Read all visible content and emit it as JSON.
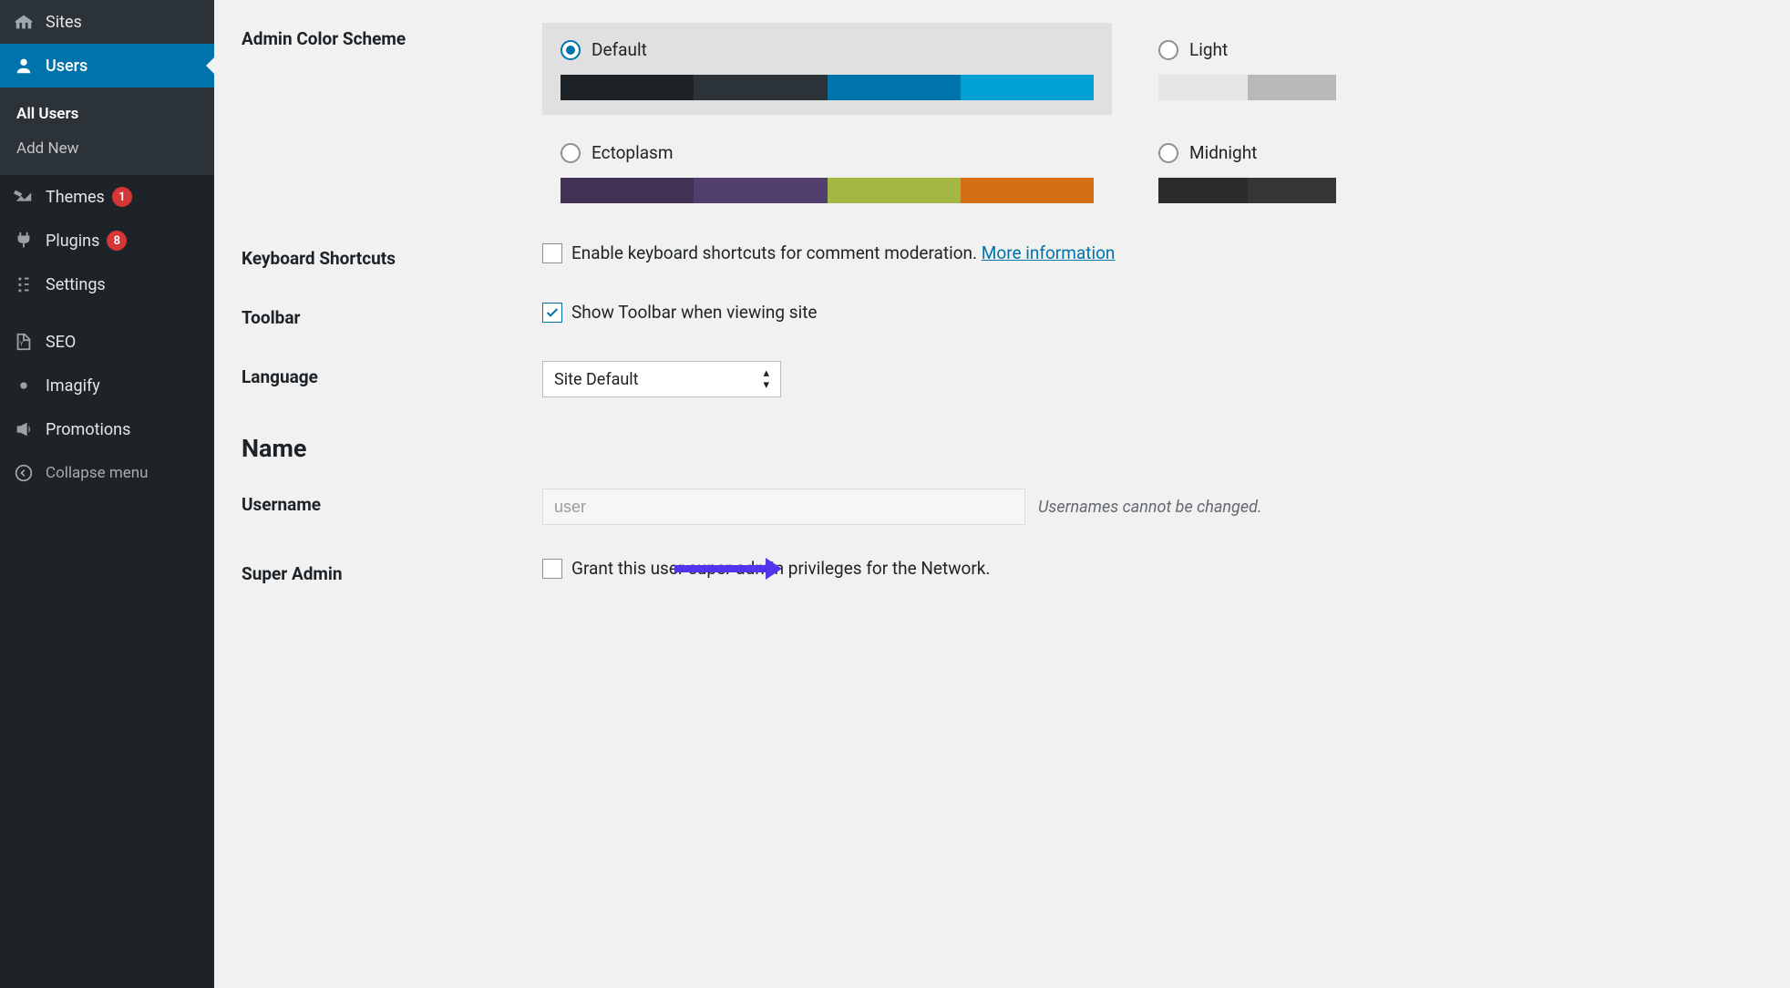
{
  "sidebar": {
    "items": [
      {
        "name": "sites",
        "label": "Sites",
        "icon": "sites-icon"
      },
      {
        "name": "users",
        "label": "Users",
        "icon": "users-icon",
        "active": true
      },
      {
        "name": "themes",
        "label": "Themes",
        "icon": "themes-icon",
        "badge": "1"
      },
      {
        "name": "plugins",
        "label": "Plugins",
        "icon": "plugins-icon",
        "badge": "8"
      },
      {
        "name": "settings",
        "label": "Settings",
        "icon": "settings-icon"
      },
      {
        "name": "seo",
        "label": "SEO",
        "icon": "seo-icon"
      },
      {
        "name": "imagify",
        "label": "Imagify",
        "icon": "imagify-icon"
      },
      {
        "name": "promotions",
        "label": "Promotions",
        "icon": "promotions-icon"
      }
    ],
    "submenu": {
      "items": [
        {
          "label": "All Users",
          "current": true
        },
        {
          "label": "Add New",
          "current": false
        }
      ]
    },
    "collapse_label": "Collapse menu"
  },
  "form": {
    "color_scheme_label": "Admin Color Scheme",
    "schemes": {
      "default": {
        "label": "Default",
        "colors": [
          "#1d2327",
          "#2c3338",
          "#0073aa",
          "#00a0d2"
        ]
      },
      "light": {
        "label": "Light",
        "colors": [
          "#e5e5e5",
          "#b8b8b8"
        ]
      },
      "ectoplasm": {
        "label": "Ectoplasm",
        "colors": [
          "#413256",
          "#523f6d",
          "#a3b745",
          "#d46f15"
        ]
      },
      "midnight": {
        "label": "Midnight",
        "colors": [
          "#2b2b2b",
          "#363636"
        ]
      }
    },
    "kbd_label": "Keyboard Shortcuts",
    "kbd_checkbox_label": "Enable keyboard shortcuts for comment moderation.",
    "kbd_moreinfo": "More information",
    "toolbar_label": "Toolbar",
    "toolbar_checkbox_label": "Show Toolbar when viewing site",
    "language_label": "Language",
    "language_value": "Site Default",
    "name_heading": "Name",
    "username_label": "Username",
    "username_value": "user",
    "username_hint": "Usernames cannot be changed.",
    "superadmin_label": "Super Admin",
    "superadmin_checkbox_label": "Grant this user super admin privileges for the Network."
  }
}
